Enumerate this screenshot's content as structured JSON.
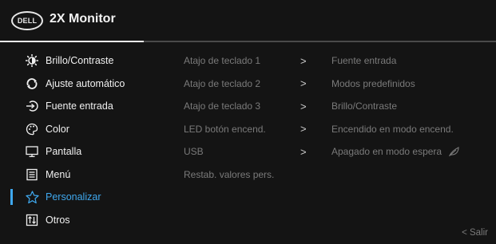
{
  "header": {
    "brand": "DELL",
    "title": "2X Monitor"
  },
  "menu": {
    "items": [
      {
        "label": "Brillo/Contraste",
        "icon": "brightness-icon"
      },
      {
        "label": "Ajuste automático",
        "icon": "auto-adjust-icon"
      },
      {
        "label": "Fuente entrada",
        "icon": "input-source-icon"
      },
      {
        "label": "Color",
        "icon": "color-icon"
      },
      {
        "label": "Pantalla",
        "icon": "display-icon"
      },
      {
        "label": "Menú",
        "icon": "menu-icon"
      },
      {
        "label": "Personalizar",
        "icon": "star-icon",
        "selected": true
      },
      {
        "label": "Otros",
        "icon": "others-icon"
      }
    ]
  },
  "personalize": {
    "options": [
      {
        "label": "Atajo de teclado 1",
        "arrow": ">",
        "value": "Fuente entrada"
      },
      {
        "label": "Atajo de teclado 2",
        "arrow": ">",
        "value": "Modos predefinidos"
      },
      {
        "label": "Atajo de teclado 3",
        "arrow": ">",
        "value": "Brillo/Contraste"
      },
      {
        "label": "LED botón encend.",
        "arrow": ">",
        "value": "Encendido en modo encend."
      },
      {
        "label": "USB",
        "arrow": ">",
        "value": "Apagado en modo espera"
      },
      {
        "label": "Restab. valores pers.",
        "arrow": "",
        "value": ""
      }
    ]
  },
  "footer": {
    "exit_label": "< Salir"
  },
  "colors": {
    "background": "#141414",
    "accent": "#3fa8ee",
    "text": "#f0f0f0",
    "muted": "#7a7a7a"
  }
}
